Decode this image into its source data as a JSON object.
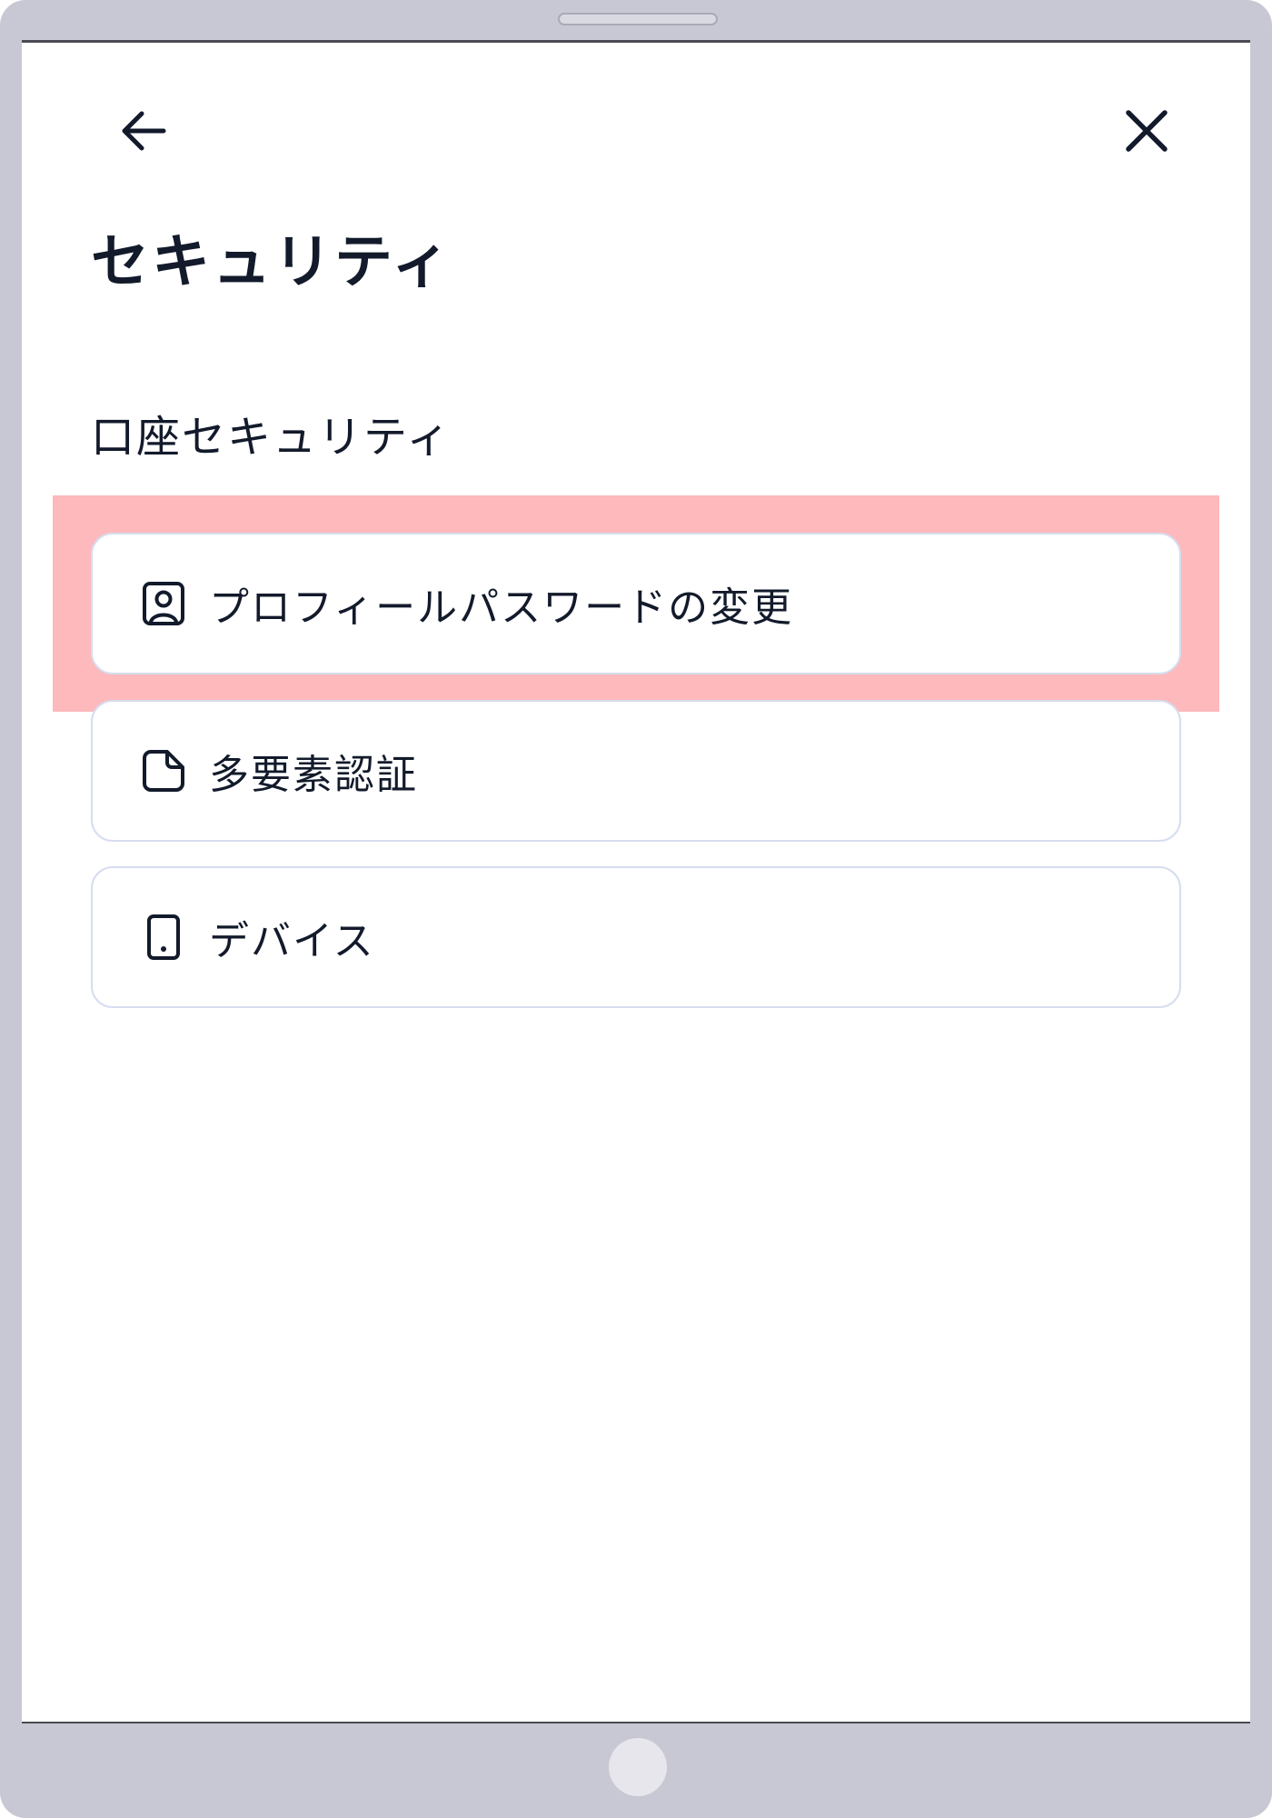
{
  "header": {
    "back_icon": "arrow-left-icon",
    "close_icon": "close-icon"
  },
  "page": {
    "title": "セキュリティ"
  },
  "section": {
    "title": "口座セキュリティ"
  },
  "menu": {
    "items": [
      {
        "label": "プロフィールパスワードの変更",
        "icon": "user-square-icon",
        "highlighted": true
      },
      {
        "label": "多要素認証",
        "icon": "document-icon",
        "highlighted": false
      },
      {
        "label": "デバイス",
        "icon": "tablet-device-icon",
        "highlighted": false
      }
    ]
  },
  "colors": {
    "frame": "#c8c8d4",
    "text": "#121a2b",
    "highlight": "#fdb9bc",
    "card_border": "#d6ddef"
  }
}
